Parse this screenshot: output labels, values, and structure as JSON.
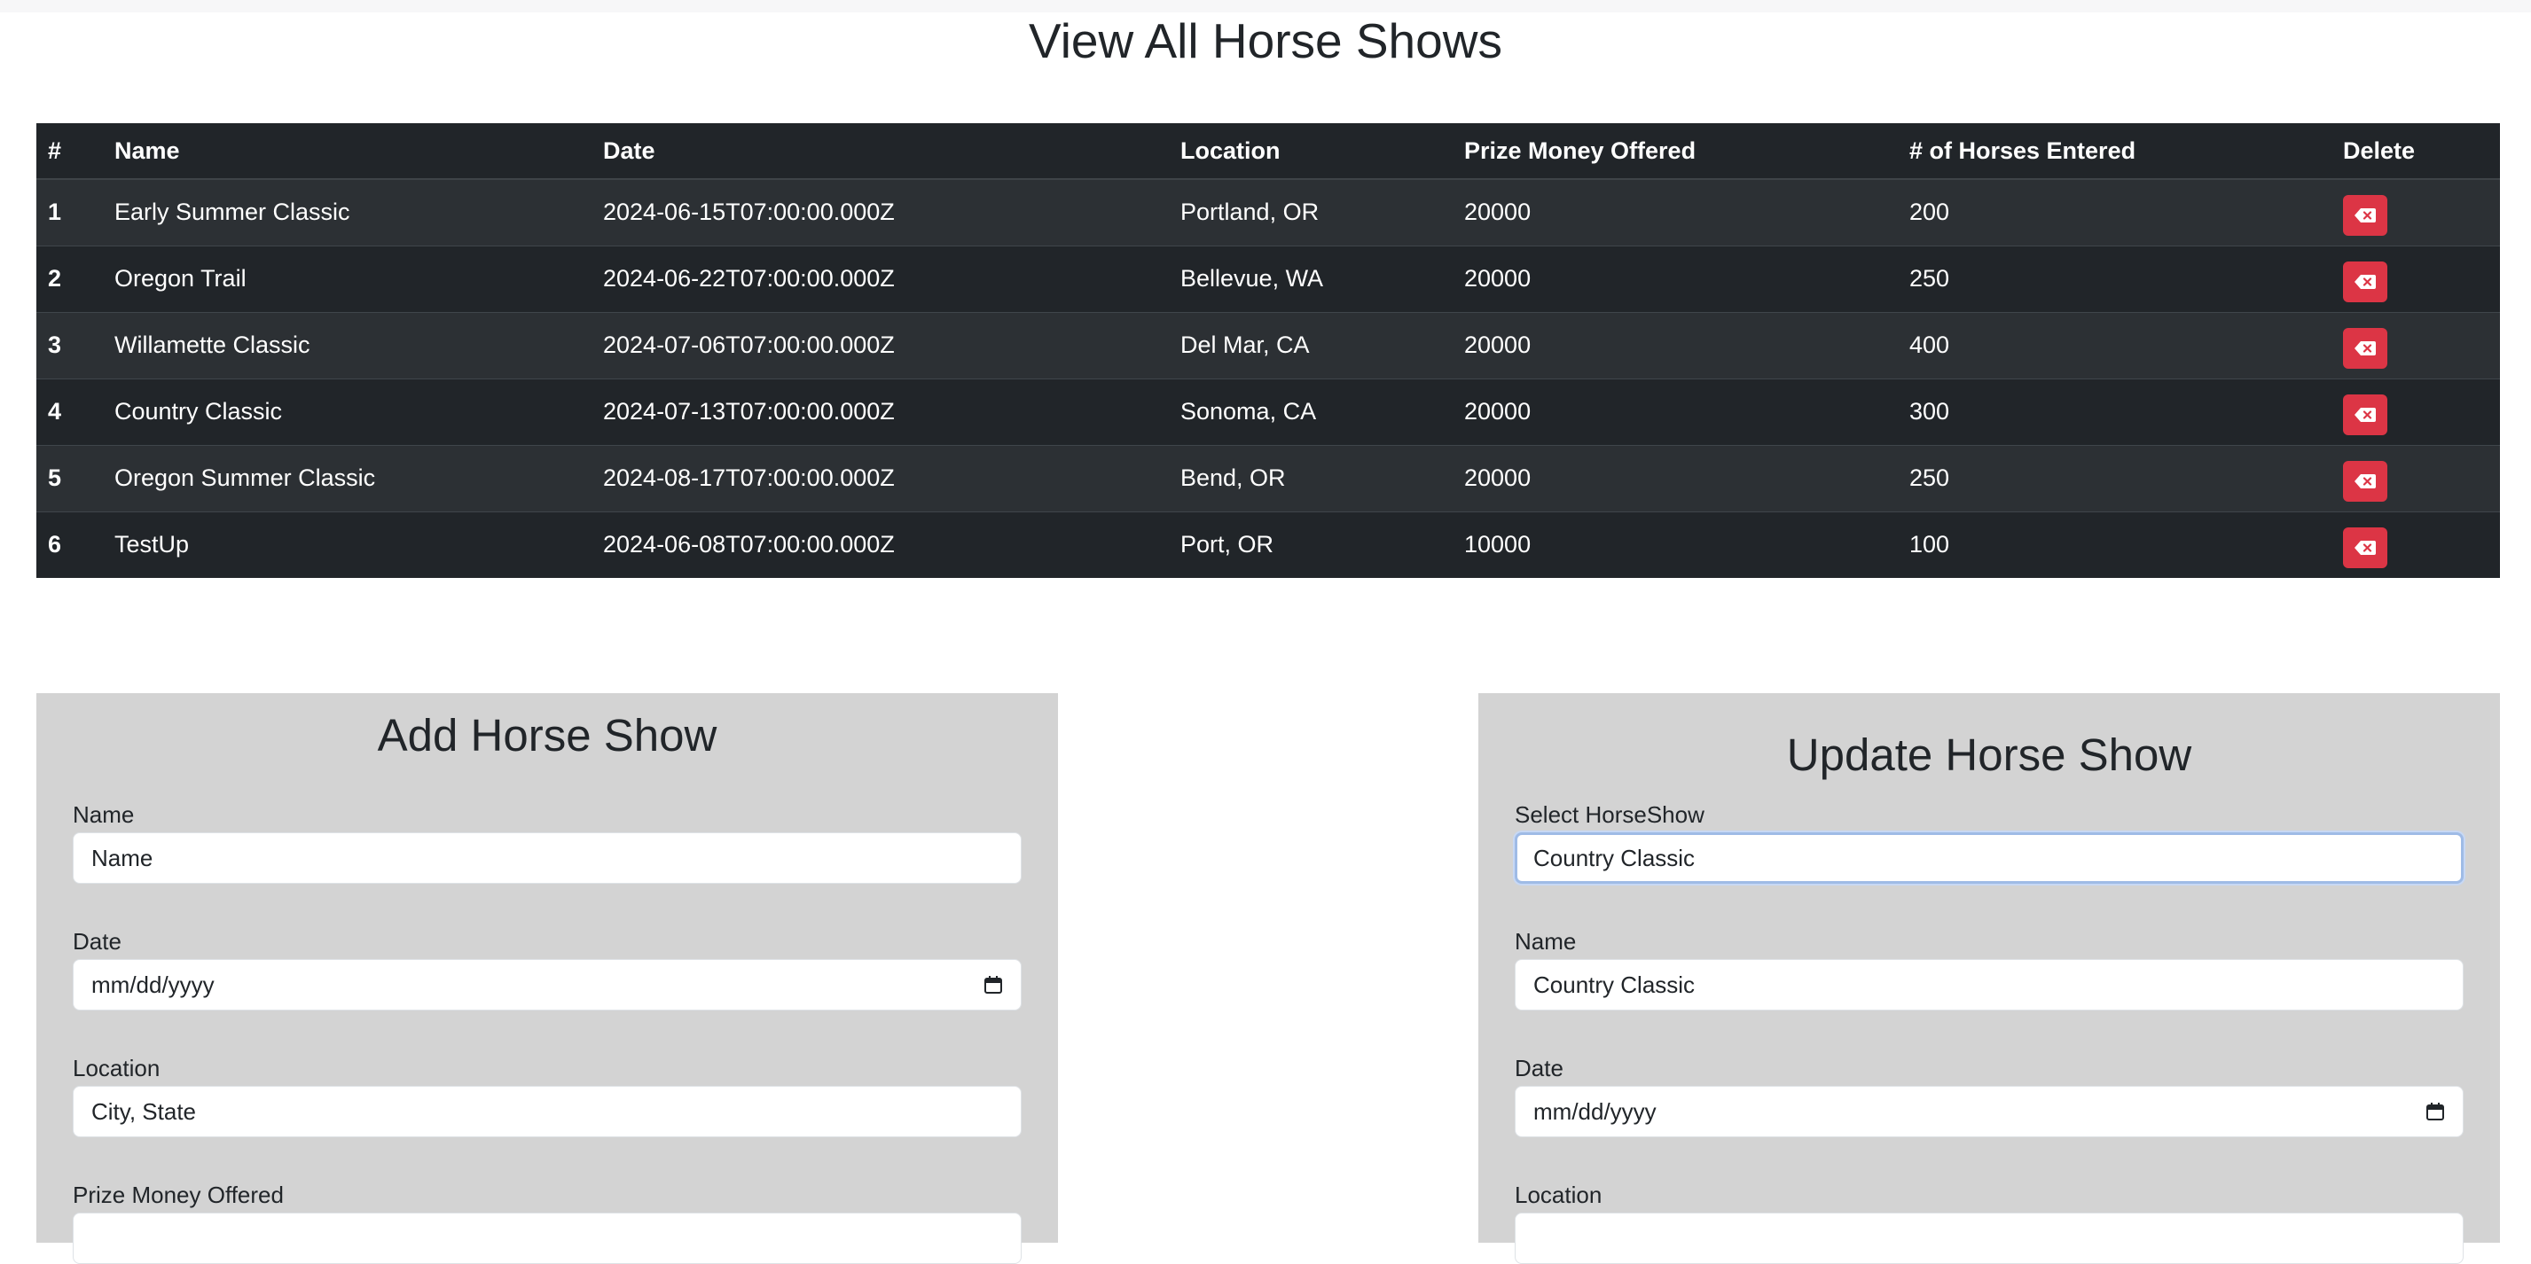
{
  "page": {
    "title": "View All Horse Shows"
  },
  "table": {
    "headers": [
      "#",
      "Name",
      "Date",
      "Location",
      "Prize Money Offered",
      "# of Horses Entered",
      "Delete"
    ],
    "rows": [
      {
        "id": "1",
        "name": "Early Summer Classic",
        "date": "2024-06-15T07:00:00.000Z",
        "location": "Portland, OR",
        "prize": "20000",
        "horses": "200"
      },
      {
        "id": "2",
        "name": "Oregon Trail",
        "date": "2024-06-22T07:00:00.000Z",
        "location": "Bellevue, WA",
        "prize": "20000",
        "horses": "250"
      },
      {
        "id": "3",
        "name": "Willamette Classic",
        "date": "2024-07-06T07:00:00.000Z",
        "location": "Del Mar, CA",
        "prize": "20000",
        "horses": "400"
      },
      {
        "id": "4",
        "name": "Country Classic",
        "date": "2024-07-13T07:00:00.000Z",
        "location": "Sonoma, CA",
        "prize": "20000",
        "horses": "300"
      },
      {
        "id": "5",
        "name": "Oregon Summer Classic",
        "date": "2024-08-17T07:00:00.000Z",
        "location": "Bend, OR",
        "prize": "20000",
        "horses": "250"
      },
      {
        "id": "6",
        "name": "TestUp",
        "date": "2024-06-08T07:00:00.000Z",
        "location": "Port, OR",
        "prize": "10000",
        "horses": "100"
      }
    ]
  },
  "add_form": {
    "title": "Add Horse Show",
    "name_label": "Name",
    "name_placeholder": "Name",
    "date_label": "Date",
    "date_placeholder": "mm/dd/yyyy",
    "location_label": "Location",
    "location_placeholder": "City, State",
    "prize_label": "Prize Money Offered"
  },
  "update_form": {
    "title": "Update Horse Show",
    "select_label": "Select HorseShow",
    "select_value": "Country Classic",
    "name_label": "Name",
    "name_value": "Country Classic",
    "date_label": "Date",
    "date_placeholder": "mm/dd/yyyy",
    "location_label": "Location"
  },
  "icons": {
    "delete": "backspace-x-icon",
    "calendar": "calendar-icon"
  },
  "colors": {
    "table_bg": "#212529",
    "table_stripe": "#2c3034",
    "delete_btn": "#dc3545",
    "panel_bg": "#d3d3d3"
  }
}
